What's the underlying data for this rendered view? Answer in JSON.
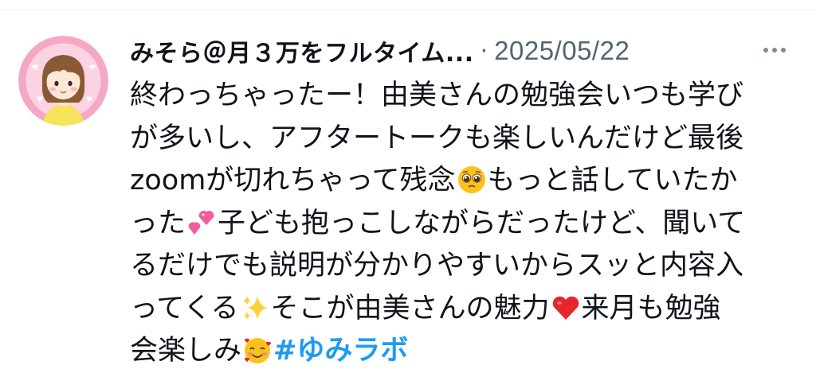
{
  "tweet": {
    "display_name": "みそら＠月３万をフルタイム...",
    "separator": "·",
    "timestamp": "2025/05/22",
    "more_icon": "more-horizontal-icon",
    "lines": [
      {
        "text": "終わっちゃったー！由美さんの勉強会いつも学び"
      },
      {
        "text": "が多いし、アフタートークも楽しいんだけど最後"
      },
      {
        "text": "zoomが切れちゃって残念",
        "emoji": "pleading-face-icon",
        "after": "もっと話していたか"
      },
      {
        "text": "った",
        "emoji": "two-hearts-icon",
        "after": "子ども抱っこしながらだったけど、聞いて"
      },
      {
        "text": "るだけでも説明が分かりやすいからスッと内容入"
      },
      {
        "text": "ってくる",
        "emoji": "sparkles-icon",
        "after": "そこが由美さんの魅力",
        "emoji2": "red-heart-icon",
        "after2": "来月も勉強"
      },
      {
        "text": "会楽しみ",
        "emoji": "smiling-face-with-hearts-icon",
        "hashtag": "#ゆみラボ"
      }
    ]
  },
  "colors": {
    "text": "#0f1419",
    "secondary": "#536471",
    "hashtag": "#1d9bf0",
    "avatar_bg": "#f6a9c7"
  }
}
